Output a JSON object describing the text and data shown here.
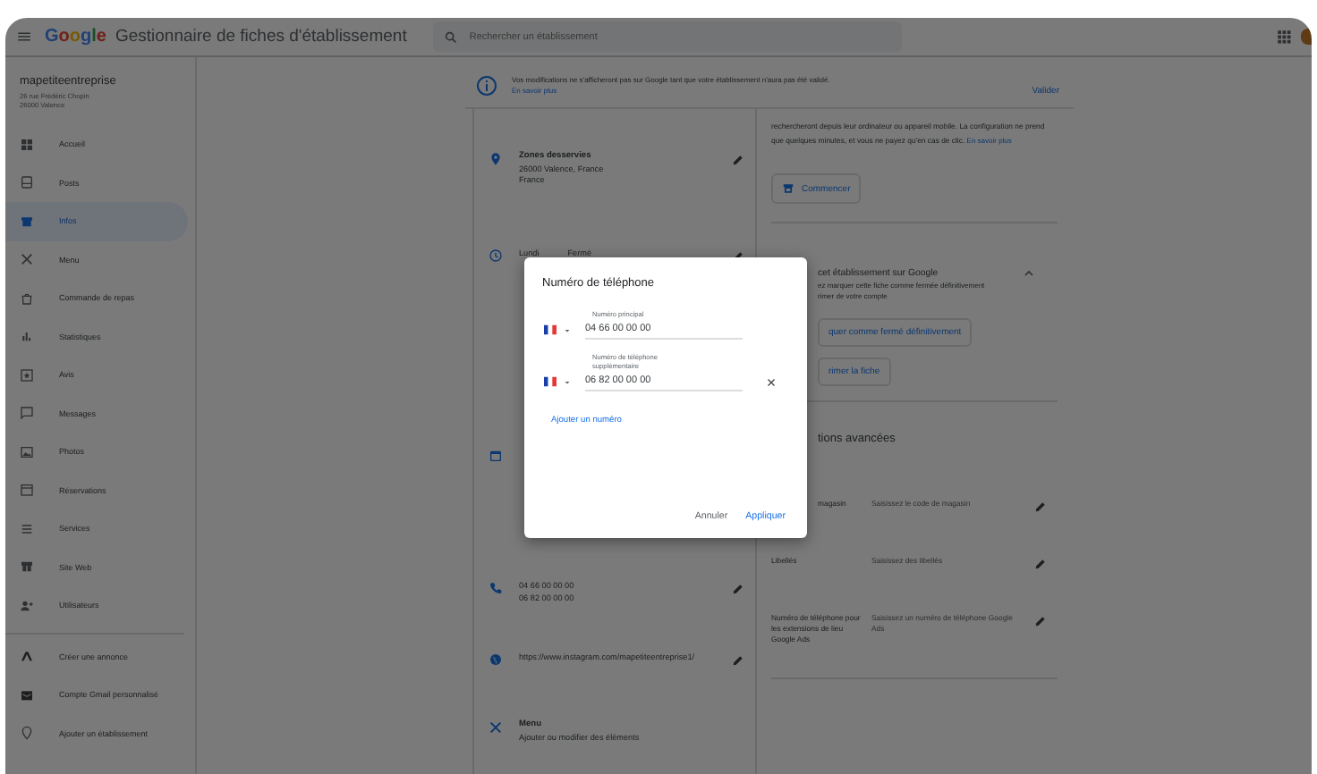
{
  "header": {
    "logo": "Google",
    "product": "Gestionnaire de fiches d'établissement",
    "search_placeholder": "Rechercher un établissement"
  },
  "business": {
    "name": "mapetiteentreprise",
    "address_lines": [
      "26 rue Frédéric Chopin",
      "26000 Valence"
    ]
  },
  "sidebar": {
    "items": [
      {
        "label": "Accueil",
        "selected": false
      },
      {
        "label": "Posts",
        "selected": false
      },
      {
        "label": "Infos",
        "selected": true
      },
      {
        "label": "Menu",
        "selected": false
      },
      {
        "label": "Commande de repas",
        "selected": false
      },
      {
        "label": "Statistiques",
        "selected": false
      },
      {
        "label": "Avis",
        "selected": false
      },
      {
        "label": "Messages",
        "selected": false
      },
      {
        "label": "Photos",
        "selected": false
      },
      {
        "label": "Réservations",
        "selected": false
      },
      {
        "label": "Services",
        "selected": false
      },
      {
        "label": "Site Web",
        "selected": false
      },
      {
        "label": "Utilisateurs",
        "selected": false
      }
    ],
    "extra_items": [
      "Créer une annonce",
      "Compte Gmail personnalisé",
      "Ajouter un établissement"
    ]
  },
  "banner": {
    "message": "Vos modifications ne s'afficheront pas sur Google tant que votre établissement n'aura pas été validé.",
    "link": "En savoir plus",
    "action": "Valider"
  },
  "info_rows": [
    {
      "kind": "text",
      "title": "Zones desservies",
      "lines": [
        "26000 Valence, France",
        "France"
      ],
      "editable": true
    },
    {
      "kind": "hours",
      "hours": [
        {
          "day": "Lundi",
          "value": "Fermé"
        }
      ],
      "editable": true
    },
    {
      "kind": "hidden"
    },
    {
      "kind": "text",
      "lines": [
        "04 66 00 00 00",
        "06 82 00 00 00"
      ],
      "editable": true
    },
    {
      "kind": "text",
      "lines": [
        "https://www.instagram.com/mapetiteentreprise1/"
      ],
      "editable": true
    },
    {
      "kind": "text",
      "title": "Menu",
      "lines": [
        "Ajouter ou modifier des éléments"
      ],
      "editable": false
    }
  ],
  "ads": {
    "text": "rechercheront depuis leur ordinateur ou appareil mobile. La configuration ne prend que quelques minutes, et vous ne payez qu'en cas de clic.",
    "link": "En savoir plus",
    "button": "Commencer"
  },
  "close_section": {
    "title": "cet établissement sur Google",
    "expanded": true,
    "lines": [
      "ez marquer cette fiche comme fermée définitivement",
      "rimer de votre compte"
    ],
    "buttons": [
      "quer comme fermé définitivement",
      "rimer la fiche"
    ]
  },
  "advanced": {
    "title": "tions avancées",
    "rows": [
      {
        "label": "magasin",
        "placeholder": "Saisissez le code de magasin"
      },
      {
        "label": "Libellés",
        "placeholder": "Saisissez des libellés"
      },
      {
        "label": "Numéro de téléphone pour les extensions de lieu Google Ads",
        "placeholder": "Saisissez un numéro de téléphone Google Ads"
      }
    ]
  },
  "dialog": {
    "title": "Numéro de téléphone",
    "fields": [
      {
        "label": "Numéro principal",
        "value": "04 66 00 00 00",
        "clearable": false
      },
      {
        "label": "Numéro de téléphone supplémentaire",
        "value": "06 82 00 00 00",
        "clearable": true
      }
    ],
    "add_link": "Ajouter un numéro",
    "buttons": [
      "Annuler",
      "Appliquer"
    ]
  }
}
